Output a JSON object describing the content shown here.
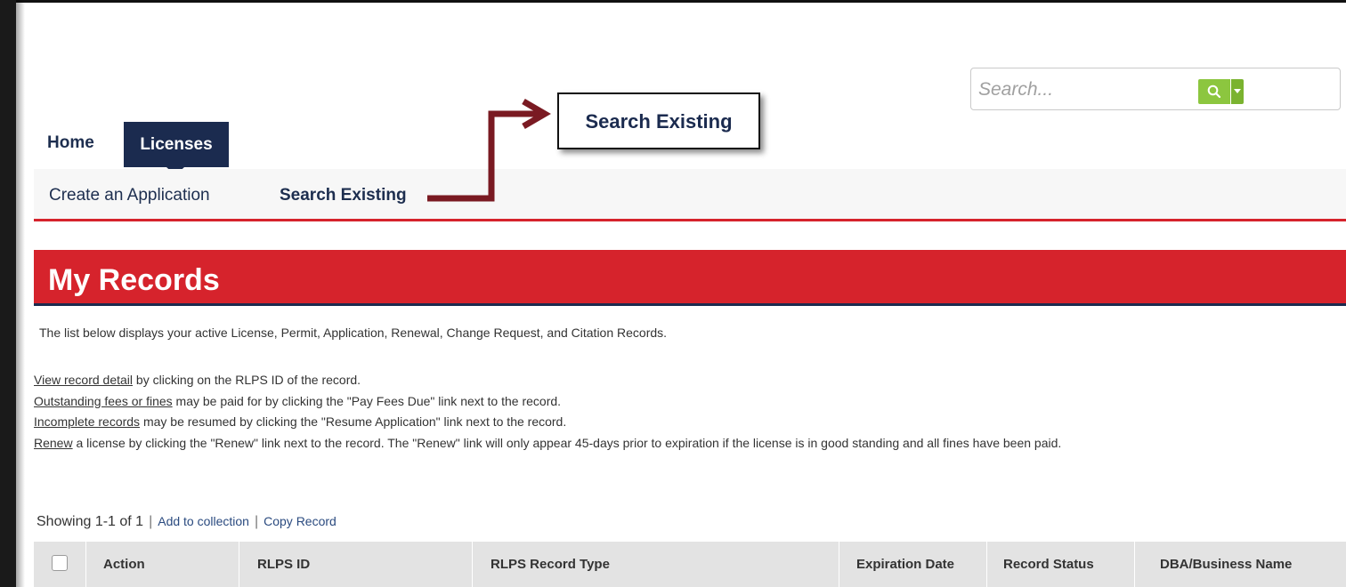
{
  "search": {
    "placeholder": "Search..."
  },
  "nav": {
    "home": "Home",
    "licenses": "Licenses"
  },
  "subnav": {
    "create": "Create an Application",
    "search_existing": "Search Existing"
  },
  "callout": {
    "label": "Search Existing"
  },
  "banner": {
    "title": "My Records"
  },
  "description": "The list below displays your active License, Permit, Application, Renewal, Change Request, and Citation Records.",
  "instructions": [
    {
      "link": "View record detail",
      "text": " by clicking on the RLPS ID of the record."
    },
    {
      "link": "Outstanding fees or fines",
      "text": " may be paid for by clicking the \"Pay Fees Due\" link next to the record."
    },
    {
      "link": "Incomplete records",
      "text": " may be resumed by clicking the \"Resume Application\" link next to the record."
    },
    {
      "link": "Renew",
      "text": " a license by clicking the \"Renew\" link next to the record. The \"Renew\" link will only appear 45-days prior to expiration if the license is in good standing and all fines have been paid."
    }
  ],
  "list": {
    "showing": "Showing 1-1 of 1",
    "add_to_collection": "Add to collection",
    "copy_record": "Copy Record"
  },
  "table": {
    "columns": [
      "Action",
      "RLPS ID",
      "RLPS Record Type",
      "Expiration Date",
      "Record Status",
      "DBA/Business Name"
    ]
  },
  "colors": {
    "accent_red": "#d6232c",
    "navy": "#1b2b4f",
    "search_green": "#8cc63f"
  },
  "icons": {
    "search": "search-icon",
    "dropdown": "caret-down-icon",
    "arrow": "callout-arrow-icon"
  }
}
